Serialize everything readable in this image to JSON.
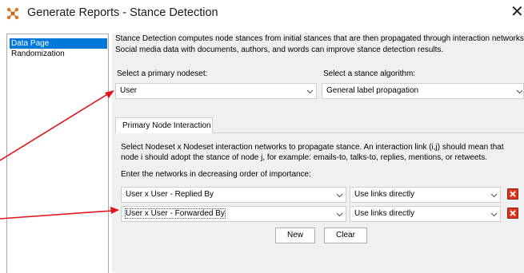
{
  "window": {
    "title": "Generate Reports - Stance Detection",
    "close_glyph": "✕",
    "accent": "#0078d7"
  },
  "nav": {
    "items": [
      {
        "label": "Data Page",
        "selected": true
      },
      {
        "label": "Randomization",
        "selected": false
      }
    ]
  },
  "description": {
    "line1": "Stance Detection computes node stances from initial stances that are then propagated through interaction networks.",
    "line2": "Social media data with documents, authors, and words can improve stance detection results."
  },
  "primary_nodeset": {
    "label": "Select a primary nodeset:",
    "value": "User"
  },
  "stance_algorithm": {
    "label": "Select a stance algorithm:",
    "value": "General label propagation"
  },
  "tab": {
    "label": "Primary Node Interaction"
  },
  "interaction": {
    "line1": "Select Nodeset x Nodeset interaction networks to propagate stance. An interaction link (i,j) should mean that",
    "line2": "node i should adopt the stance of node j, for example: emails-to, talks-to, replies, mentions, or retweets.",
    "order_label": "Enter the networks in decreasing order of importance:"
  },
  "networks": [
    {
      "network": "User x User - Replied By",
      "mode": "Use links directly"
    },
    {
      "network": "User x User - Forwarded By",
      "mode": "Use links directly"
    }
  ],
  "buttons": {
    "new_label": "New",
    "clear_label": "Clear"
  },
  "colors": {
    "annotation_arrow": "#e0141e",
    "delete_button": "#d7371f"
  }
}
